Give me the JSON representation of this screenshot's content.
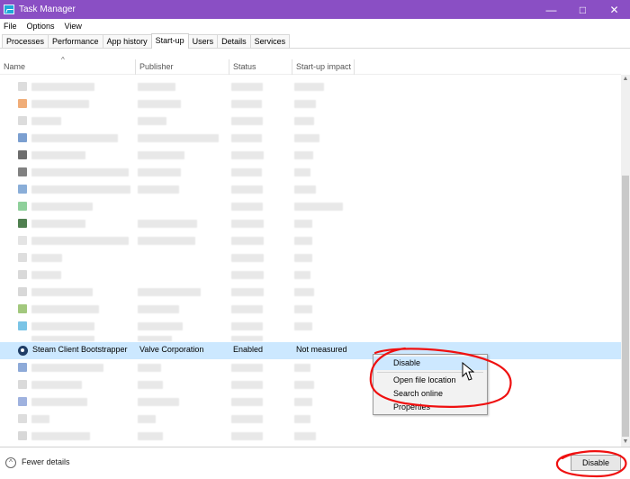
{
  "window": {
    "title": "Task Manager",
    "minimize": "—",
    "maximize": "□",
    "close": "✕"
  },
  "menu": [
    "File",
    "Options",
    "View"
  ],
  "tabs": [
    "Processes",
    "Performance",
    "App history",
    "Start-up",
    "Users",
    "Details",
    "Services"
  ],
  "columns": {
    "name": "Name",
    "publisher": "Publisher",
    "status": "Status",
    "impact": "Start-up impact"
  },
  "selected_row": {
    "name": "Steam Client Bootstrapper",
    "publisher": "Valve Corporation",
    "status": "Enabled",
    "impact": "Not measured"
  },
  "context_menu": [
    "Disable",
    "Open file location",
    "Search online",
    "Properties"
  ],
  "footer": {
    "fewer_details": "Fewer details",
    "disable_button": "Disable"
  },
  "icons": {
    "app": "task-manager-icon",
    "steam": "steam-icon",
    "fewer_details": "chevron-up-icon"
  },
  "colors": {
    "titlebar": "#8a4fc4",
    "selected_row": "#cce8ff",
    "annotation": "#ef1010"
  }
}
